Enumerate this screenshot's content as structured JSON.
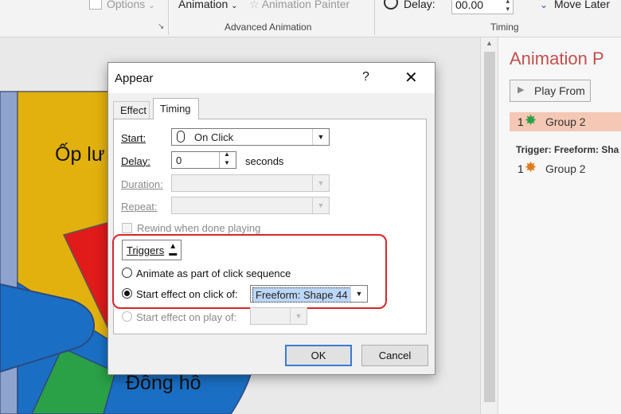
{
  "ribbon": {
    "options_label": "Options",
    "animation_label": "Animation",
    "animation_painter_label": "Animation Painter",
    "advanced_animation_label": "Advanced Animation",
    "delay_label": "Delay:",
    "delay_value": "00.00",
    "move_later_label": "Move Later",
    "timing_group_label": "Timing"
  },
  "slide": {
    "text_top": "Ốp lư",
    "text_bottom": "Đồng hồ",
    "colors": {
      "yellow": "#e3b10e",
      "blue": "#1a6fc4",
      "red": "#e11a1a",
      "green": "#2aa047",
      "lavender": "#8fa3cf"
    }
  },
  "pane": {
    "title": "Animation P",
    "play_from_label": "Play From",
    "item1_number": "1",
    "item1_label": "Group 2",
    "trigger_header": "Trigger: Freeform: Sha",
    "item2_number": "1",
    "item2_label": "Group 2"
  },
  "dialog": {
    "title": "Appear",
    "help": "?",
    "tabs": [
      "Effect",
      "Timing"
    ],
    "start_label": "Start:",
    "start_value": "On Click",
    "delay_label": "Delay:",
    "delay_value": "0",
    "seconds_label": "seconds",
    "duration_label": "Duration:",
    "repeat_label": "Repeat:",
    "rewind_label": "Rewind when done playing",
    "triggers_label": "Triggers",
    "animate_sequence_label": "Animate as part of click sequence",
    "start_on_click_label": "Start effect on click of:",
    "start_on_click_value": "Freeform: Shape 44",
    "start_on_play_label": "Start effect on play of:",
    "ok_label": "OK",
    "cancel_label": "Cancel",
    "highlight_color": "#d8262c"
  }
}
